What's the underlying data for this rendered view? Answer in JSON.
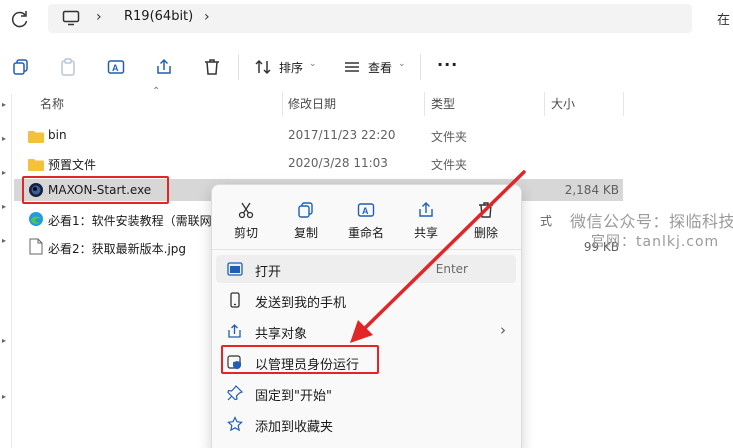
{
  "address": {
    "breadcrumb": "R19(64bit)",
    "search_placeholder": "在"
  },
  "toolbar": {
    "sort_label": "排序",
    "view_label": "查看",
    "more_label": "···"
  },
  "columns": {
    "name": "名称",
    "date": "修改日期",
    "type": "类型",
    "size": "大小"
  },
  "files": [
    {
      "name": "bin",
      "date": "2017/11/23 22:20",
      "type": "文件夹",
      "size": "",
      "icon": "folder-icon"
    },
    {
      "name": "预置文件",
      "date": "2020/3/28 11:03",
      "type": "文件夹",
      "size": "",
      "icon": "folder-icon"
    },
    {
      "name": "MAXON-Start.exe",
      "date": "",
      "type": "",
      "size": "2,184 KB",
      "icon": "cinema4d-icon",
      "selected": true
    },
    {
      "name": "必看1：软件安装教程（需联网",
      "date": "",
      "type": "式",
      "size": "",
      "icon": "edge-icon"
    },
    {
      "name": "必看2：获取最新版本.jpg",
      "date": "",
      "type": "",
      "size": "99 KB",
      "icon": "image-file-icon"
    }
  ],
  "context_menu": {
    "quick_actions": [
      {
        "label": "剪切",
        "icon": "scissors-icon"
      },
      {
        "label": "复制",
        "icon": "copy-icon"
      },
      {
        "label": "重命名",
        "icon": "rename-icon"
      },
      {
        "label": "共享",
        "icon": "share-icon"
      },
      {
        "label": "删除",
        "icon": "trash-icon"
      }
    ],
    "items": [
      {
        "label": "打开",
        "shortcut": "Enter",
        "icon": "open-icon"
      },
      {
        "label": "发送到我的手机",
        "icon": "phone-icon"
      },
      {
        "label": "共享对象",
        "icon": "share-icon",
        "submenu": true
      },
      {
        "label": "以管理员身份运行",
        "icon": "admin-shield-icon"
      },
      {
        "label": "固定到\"开始\"",
        "icon": "pin-icon"
      },
      {
        "label": "添加到收藏夹",
        "icon": "star-icon"
      }
    ]
  },
  "watermark": {
    "line1": "微信公众号：探临科技",
    "line2": "官网：tanlkj.com"
  },
  "accent_colors": {
    "annotation_red": "#e02626",
    "selection_gray": "#d7d7d7",
    "folder_yellow": "#f4c23a",
    "icon_blue": "#1f5fb4"
  }
}
